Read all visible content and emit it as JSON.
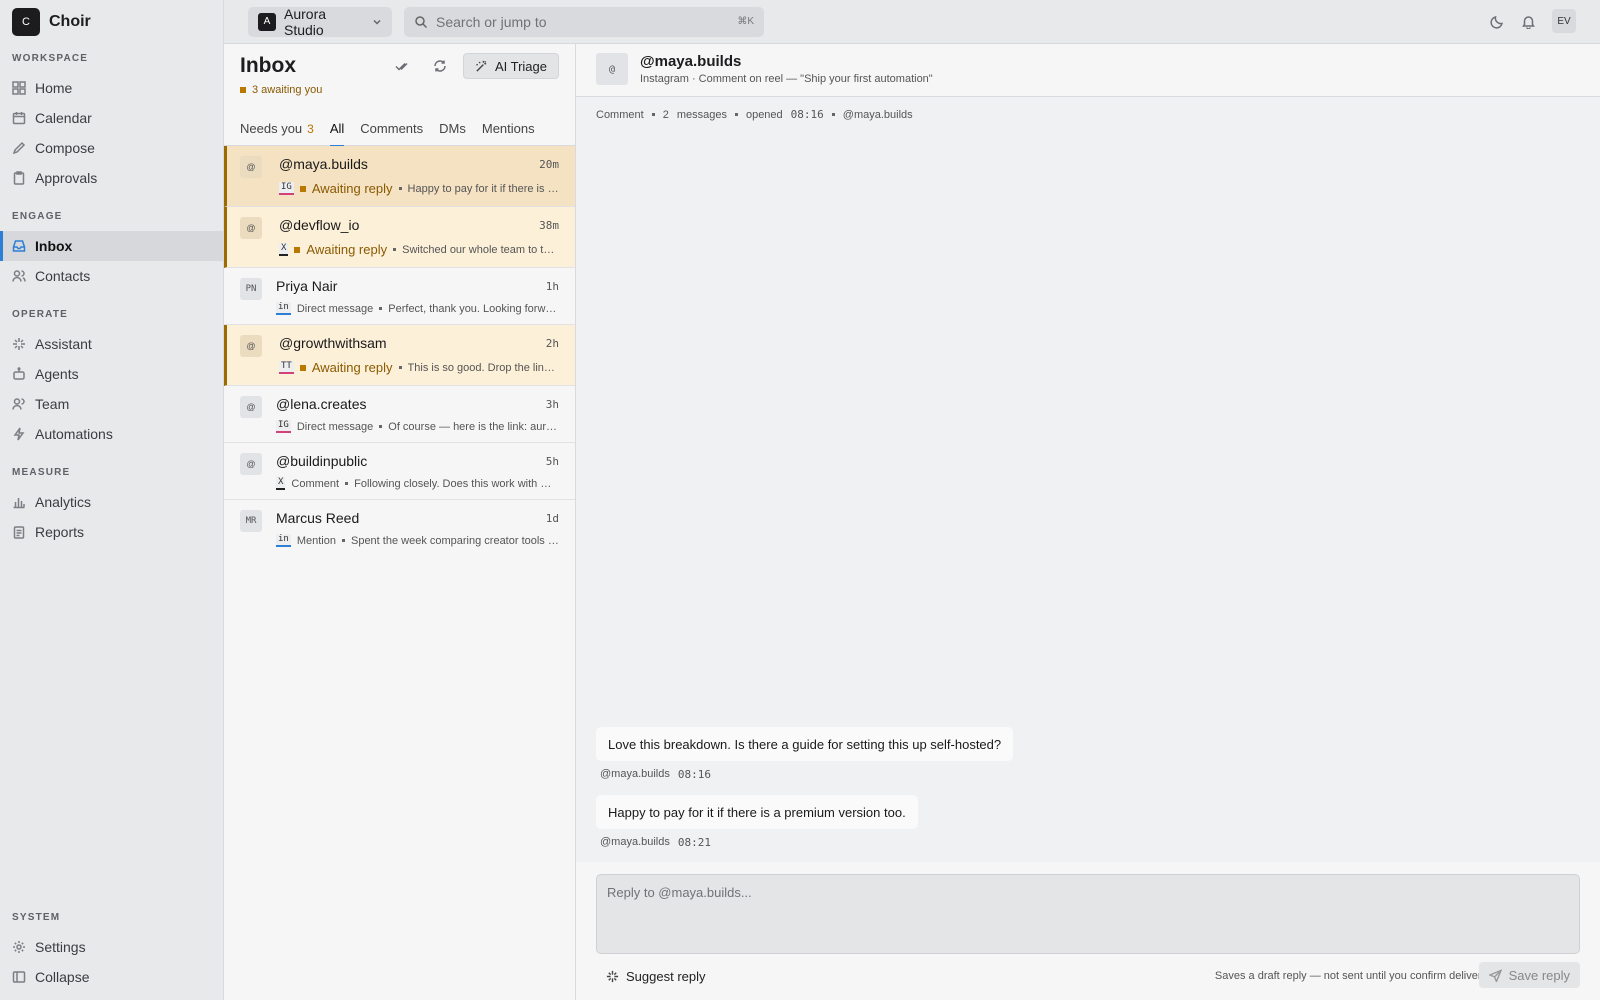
{
  "brand": {
    "logo": "C",
    "name": "Choir"
  },
  "sidebar": {
    "sections": [
      {
        "title": "WORKSPACE",
        "items": [
          {
            "label": "Home",
            "icon": "grid-icon"
          },
          {
            "label": "Calendar",
            "icon": "calendar-icon"
          },
          {
            "label": "Compose",
            "icon": "pen-icon"
          },
          {
            "label": "Approvals",
            "icon": "clipboard-icon"
          }
        ]
      },
      {
        "title": "ENGAGE",
        "items": [
          {
            "label": "Inbox",
            "icon": "inbox-icon",
            "active": true
          },
          {
            "label": "Contacts",
            "icon": "users-icon"
          }
        ]
      },
      {
        "title": "OPERATE",
        "items": [
          {
            "label": "Assistant",
            "icon": "sparkle-icon"
          },
          {
            "label": "Agents",
            "icon": "bot-icon"
          },
          {
            "label": "Team",
            "icon": "team-icon"
          },
          {
            "label": "Automations",
            "icon": "bolt-icon"
          }
        ]
      },
      {
        "title": "MEASURE",
        "items": [
          {
            "label": "Analytics",
            "icon": "bar-chart-icon"
          },
          {
            "label": "Reports",
            "icon": "report-icon"
          }
        ]
      },
      {
        "title": "SYSTEM",
        "items": [
          {
            "label": "Settings",
            "icon": "gear-icon"
          },
          {
            "label": "Collapse",
            "icon": "collapse-icon"
          }
        ]
      }
    ]
  },
  "topbar": {
    "workspace_badge": "A",
    "workspace_name": "Aurora Studio",
    "search_placeholder": "Search or jump to",
    "search_shortcut": "⌘K",
    "avatar_initials": "EV"
  },
  "inbox": {
    "title": "Inbox",
    "awaiting_text": "3 awaiting you",
    "triage_label": "AI Triage",
    "tabs": [
      {
        "label": "Needs you",
        "count": "3"
      },
      {
        "label": "All",
        "active": true
      },
      {
        "label": "Comments"
      },
      {
        "label": "DMs"
      },
      {
        "label": "Mentions"
      }
    ],
    "conversations": [
      {
        "avatar": "@",
        "name": "@maya.builds",
        "time": "20m",
        "channel": "IG",
        "status": "Awaiting reply",
        "awaiting": true,
        "selected": true,
        "preview": "Happy to pay for it if there is a premium version too."
      },
      {
        "avatar": "@",
        "name": "@devflow_io",
        "time": "38m",
        "channel": "X",
        "status": "Awaiting reply",
        "awaiting": true,
        "preview": "Switched our whole team to this last month."
      },
      {
        "avatar": "PN",
        "name": "Priya Nair",
        "time": "1h",
        "channel": "in",
        "status": "Direct message",
        "preview": "Perfect, thank you. Looking forward to it."
      },
      {
        "avatar": "@",
        "name": "@growthwithsam",
        "time": "2h",
        "channel": "TT",
        "status": "Awaiting reply",
        "awaiting": true,
        "preview": "This is so good. Drop the link please!"
      },
      {
        "avatar": "@",
        "name": "@lena.creates",
        "time": "3h",
        "channel": "IG",
        "status": "Direct message",
        "preview": "Of course — here is the link: aurora.studio/guide"
      },
      {
        "avatar": "@",
        "name": "@buildinpublic",
        "time": "5h",
        "channel": "X",
        "status": "Comment",
        "preview": "Following closely. Does this work with webhooks?"
      },
      {
        "avatar": "MR",
        "name": "Marcus Reed",
        "time": "1d",
        "channel": "in",
        "status": "Mention",
        "preview": "Spent the week comparing creator tools and this one wins."
      }
    ]
  },
  "detail": {
    "avatar": "@",
    "name": "@maya.builds",
    "subtitle": "Instagram · Comment on reel — \"Ship your first automation\"",
    "meta": {
      "type": "Comment",
      "count": "2",
      "count_label": "messages",
      "opened_label": "opened",
      "opened_time": "08:16",
      "handle": "@maya.builds"
    },
    "messages": [
      {
        "text": "Love this breakdown. Is there a guide for setting this up self-hosted?",
        "author": "@maya.builds",
        "time": "08:16"
      },
      {
        "text": "Happy to pay for it if there is a premium version too.",
        "author": "@maya.builds",
        "time": "08:21"
      }
    ],
    "reply_placeholder": "Reply to @maya.builds...",
    "suggest_label": "Suggest reply",
    "save_note": "Saves a draft reply — not sent until you confirm delivery",
    "save_label": "Save reply"
  }
}
